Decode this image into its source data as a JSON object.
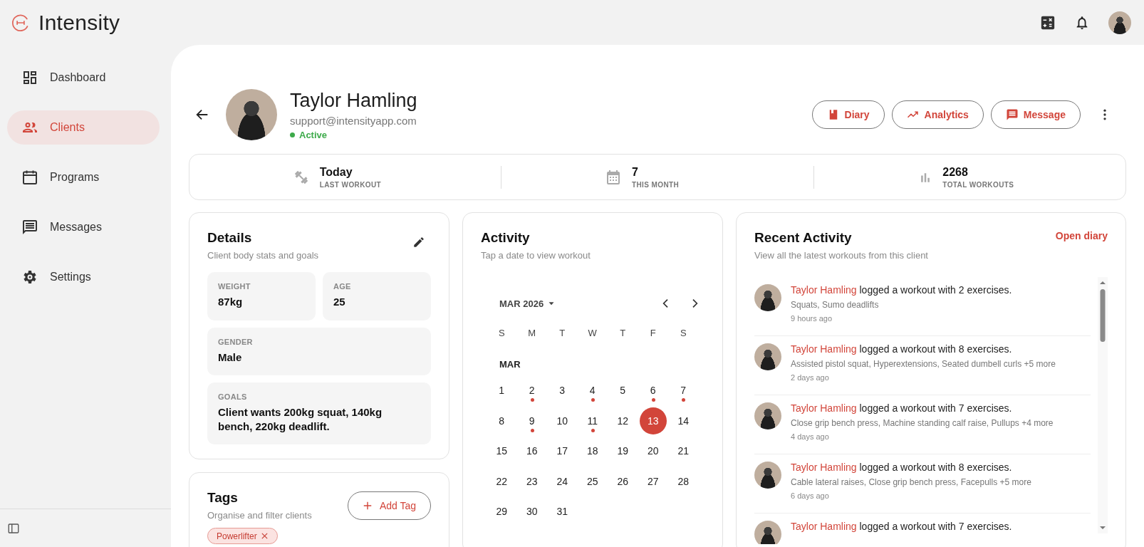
{
  "app": {
    "name": "Intensity"
  },
  "sidebar": {
    "items": [
      {
        "label": "Dashboard",
        "kind": "dashboard",
        "selected": false
      },
      {
        "label": "Clients",
        "kind": "clients",
        "selected": true
      },
      {
        "label": "Programs",
        "kind": "programs",
        "selected": false
      },
      {
        "label": "Messages",
        "kind": "messages",
        "selected": false
      },
      {
        "label": "Settings",
        "kind": "settings",
        "selected": false
      }
    ]
  },
  "client": {
    "name": "Taylor Hamling",
    "email": "support@intensityapp.com",
    "status": "Active",
    "active": true
  },
  "actions": [
    {
      "label": "Diary",
      "kind": "diary"
    },
    {
      "label": "Analytics",
      "kind": "analytics"
    },
    {
      "label": "Message",
      "kind": "message"
    }
  ],
  "stats": [
    {
      "value": "Today",
      "label": "LAST WORKOUT",
      "kind": "dumbbell"
    },
    {
      "value": "7",
      "label": "THIS MONTH",
      "kind": "calendar"
    },
    {
      "value": "2268",
      "label": "TOTAL WORKOUTS",
      "kind": "bars"
    }
  ],
  "details": {
    "title": "Details",
    "subtitle": "Client body stats and goals",
    "fields": [
      {
        "label": "WEIGHT",
        "value": "87kg",
        "wide": false
      },
      {
        "label": "AGE",
        "value": "25",
        "wide": false
      },
      {
        "label": "GENDER",
        "value": "Male",
        "wide": true
      },
      {
        "label": "GOALS",
        "value": "Client wants 200kg squat, 140kg bench, 220kg deadlift.",
        "wide": true
      }
    ]
  },
  "tags": {
    "title": "Tags",
    "subtitle": "Organise and filter clients",
    "add_button": "Add Tag",
    "items": [
      {
        "label": "Powerlifter"
      }
    ]
  },
  "activity": {
    "title": "Activity",
    "subtitle": "Tap a date to view workout",
    "month_label": "MAR 2026",
    "weekdays": [
      "S",
      "M",
      "T",
      "W",
      "T",
      "F",
      "S"
    ],
    "section": "MAR",
    "weeks": [
      [
        {
          "label": "1",
          "marked": false,
          "selected": false
        },
        {
          "label": "2",
          "marked": true,
          "selected": false
        },
        {
          "label": "3",
          "marked": false,
          "selected": false
        },
        {
          "label": "4",
          "marked": true,
          "selected": false
        },
        {
          "label": "5",
          "marked": false,
          "selected": false
        },
        {
          "label": "6",
          "marked": true,
          "selected": false
        },
        {
          "label": "7",
          "marked": true,
          "selected": false
        }
      ],
      [
        {
          "label": "8",
          "marked": false,
          "selected": false
        },
        {
          "label": "9",
          "marked": true,
          "selected": false
        },
        {
          "label": "10",
          "marked": false,
          "selected": false
        },
        {
          "label": "11",
          "marked": true,
          "selected": false
        },
        {
          "label": "12",
          "marked": false,
          "selected": false
        },
        {
          "label": "13",
          "marked": false,
          "selected": true
        },
        {
          "label": "14",
          "marked": false,
          "selected": false
        }
      ],
      [
        {
          "label": "15",
          "marked": false,
          "selected": false
        },
        {
          "label": "16",
          "marked": false,
          "selected": false
        },
        {
          "label": "17",
          "marked": false,
          "selected": false
        },
        {
          "label": "18",
          "marked": false,
          "selected": false
        },
        {
          "label": "19",
          "marked": false,
          "selected": false
        },
        {
          "label": "20",
          "marked": false,
          "selected": false
        },
        {
          "label": "21",
          "marked": false,
          "selected": false
        }
      ],
      [
        {
          "label": "22",
          "marked": false,
          "selected": false
        },
        {
          "label": "23",
          "marked": false,
          "selected": false
        },
        {
          "label": "24",
          "marked": false,
          "selected": false
        },
        {
          "label": "25",
          "marked": false,
          "selected": false
        },
        {
          "label": "26",
          "marked": false,
          "selected": false
        },
        {
          "label": "27",
          "marked": false,
          "selected": false
        },
        {
          "label": "28",
          "marked": false,
          "selected": false
        }
      ],
      [
        {
          "label": "29",
          "marked": false,
          "selected": false
        },
        {
          "label": "30",
          "marked": false,
          "selected": false
        },
        {
          "label": "31",
          "marked": false,
          "selected": false
        }
      ]
    ]
  },
  "recent": {
    "title": "Recent Activity",
    "subtitle": "View all the latest workouts from this client",
    "link": "Open diary",
    "items": [
      {
        "name": "Taylor Hamling",
        "text": "logged a workout with 2 exercises.",
        "exercises": "Squats, Sumo deadlifts",
        "time": "9 hours ago"
      },
      {
        "name": "Taylor Hamling",
        "text": "logged a workout with 8 exercises.",
        "exercises": "Assisted pistol squat, Hyperextensions, Seated dumbell curls +5 more",
        "time": "2 days ago"
      },
      {
        "name": "Taylor Hamling",
        "text": "logged a workout with 7 exercises.",
        "exercises": "Close grip bench press, Machine standing calf raise, Pullups +4 more",
        "time": "4 days ago"
      },
      {
        "name": "Taylor Hamling",
        "text": "logged a workout with 8 exercises.",
        "exercises": "Cable lateral raises, Close grip bench press, Facepulls +5 more",
        "time": "6 days ago"
      },
      {
        "name": "Taylor Hamling",
        "text": "logged a workout with 7 exercises."
      }
    ]
  }
}
